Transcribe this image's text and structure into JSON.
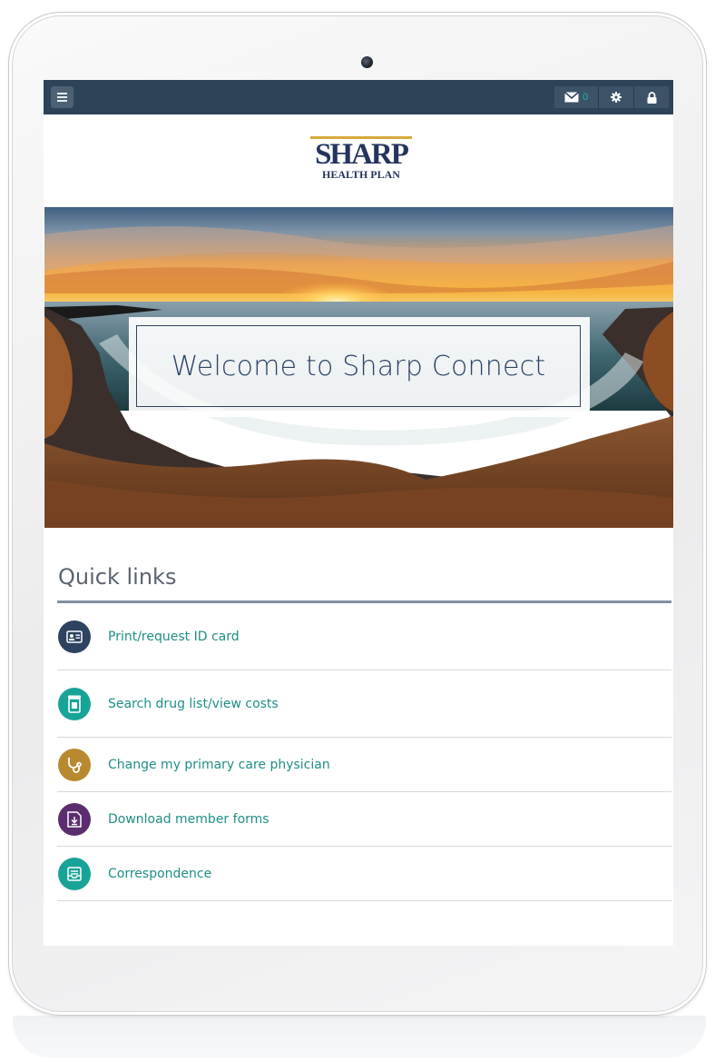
{
  "topbar": {
    "menu_icon": "hamburger-menu-icon",
    "mail_icon": "envelope-icon",
    "unread_count": "0",
    "settings_icon": "gear-icon",
    "lock_icon": "lock-icon",
    "background": "#2d4358"
  },
  "logo": {
    "line1": "SHARP",
    "line2": "HEALTH PLAN"
  },
  "hero": {
    "welcome_text": "Welcome to Sharp Connect"
  },
  "quick_links": {
    "title": "Quick links",
    "items": [
      {
        "label": "Print/request ID card",
        "icon": "id-card-icon",
        "color": "#2d4360"
      },
      {
        "label": "Search drug list/view costs",
        "icon": "prescription-icon",
        "color": "#17a497"
      },
      {
        "label": "Change my primary care physician",
        "icon": "stethoscope-icon",
        "color": "#b8892f"
      },
      {
        "label": "Download member forms",
        "icon": "download-form-icon",
        "color": "#5b2d6e"
      },
      {
        "label": "Correspondence",
        "icon": "mail-tray-icon",
        "color": "#17a497"
      }
    ]
  },
  "colors": {
    "link_text": "#1f8f86",
    "heading_text": "#5a6470",
    "logo_navy": "#25345e",
    "logo_gold": "#d8a93b"
  }
}
